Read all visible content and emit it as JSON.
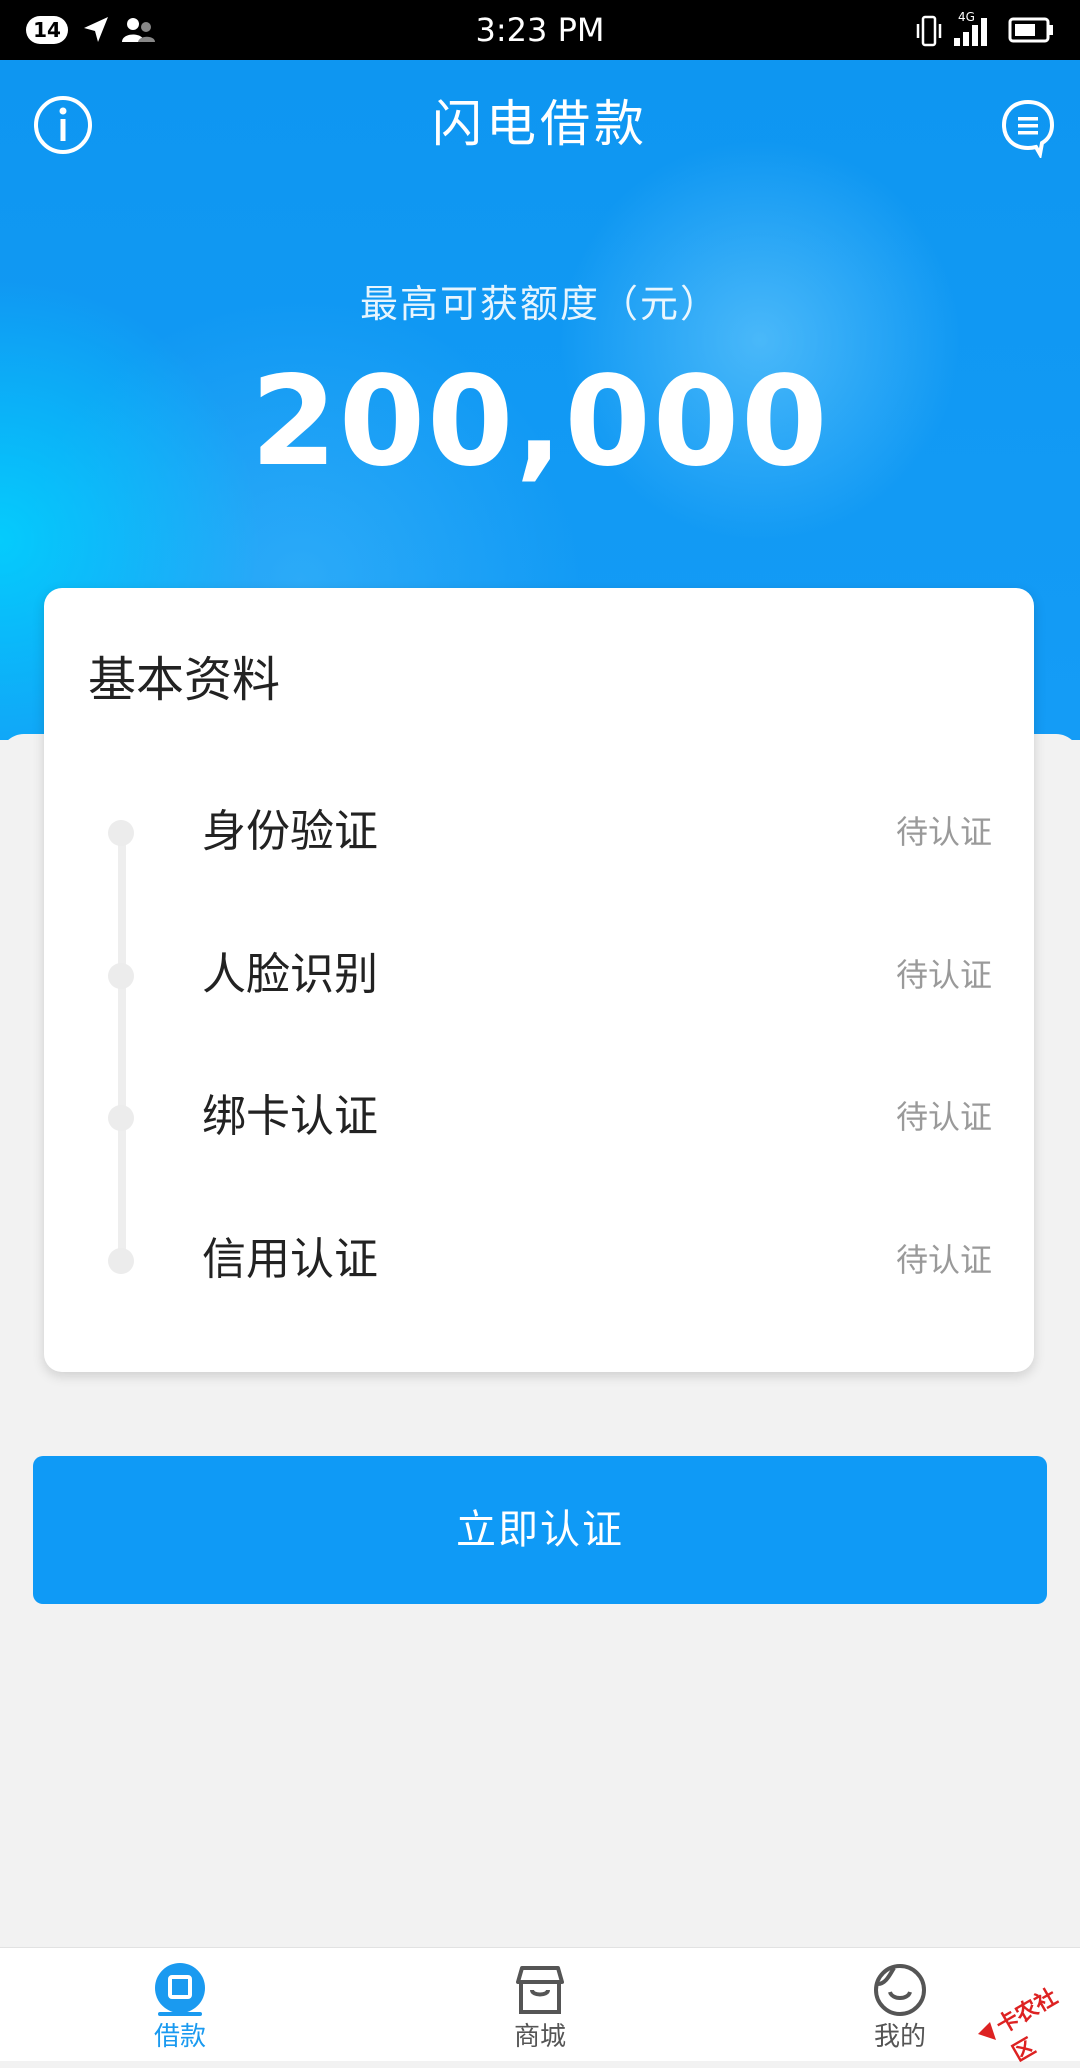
{
  "status_bar": {
    "notification_count": "14",
    "time": "3:23 PM",
    "network": "4G"
  },
  "header": {
    "title": "闪电借款",
    "left_icon": "info-icon",
    "right_icon": "message-icon"
  },
  "limit": {
    "label": "最高可获额度（元）",
    "amount": "200,000"
  },
  "profile_card": {
    "title": "基本资料",
    "steps": [
      {
        "label": "身份验证",
        "status": "待认证"
      },
      {
        "label": "人脸识别",
        "status": "待认证"
      },
      {
        "label": "绑卡认证",
        "status": "待认证"
      },
      {
        "label": "信用认证",
        "status": "待认证"
      }
    ]
  },
  "action_button": {
    "label": "立即认证"
  },
  "bottom_nav": {
    "items": [
      {
        "label": "借款",
        "icon": "loan-icon",
        "active": true
      },
      {
        "label": "商城",
        "icon": "shop-icon",
        "active": false
      },
      {
        "label": "我的",
        "icon": "profile-icon",
        "active": false
      }
    ]
  },
  "watermark": {
    "text": "卡农社区"
  },
  "colors": {
    "primary": "#0f9af6",
    "hero_light": "#00dcff",
    "status_pending": "#9a9a9a",
    "background": "#f2f2f2"
  }
}
